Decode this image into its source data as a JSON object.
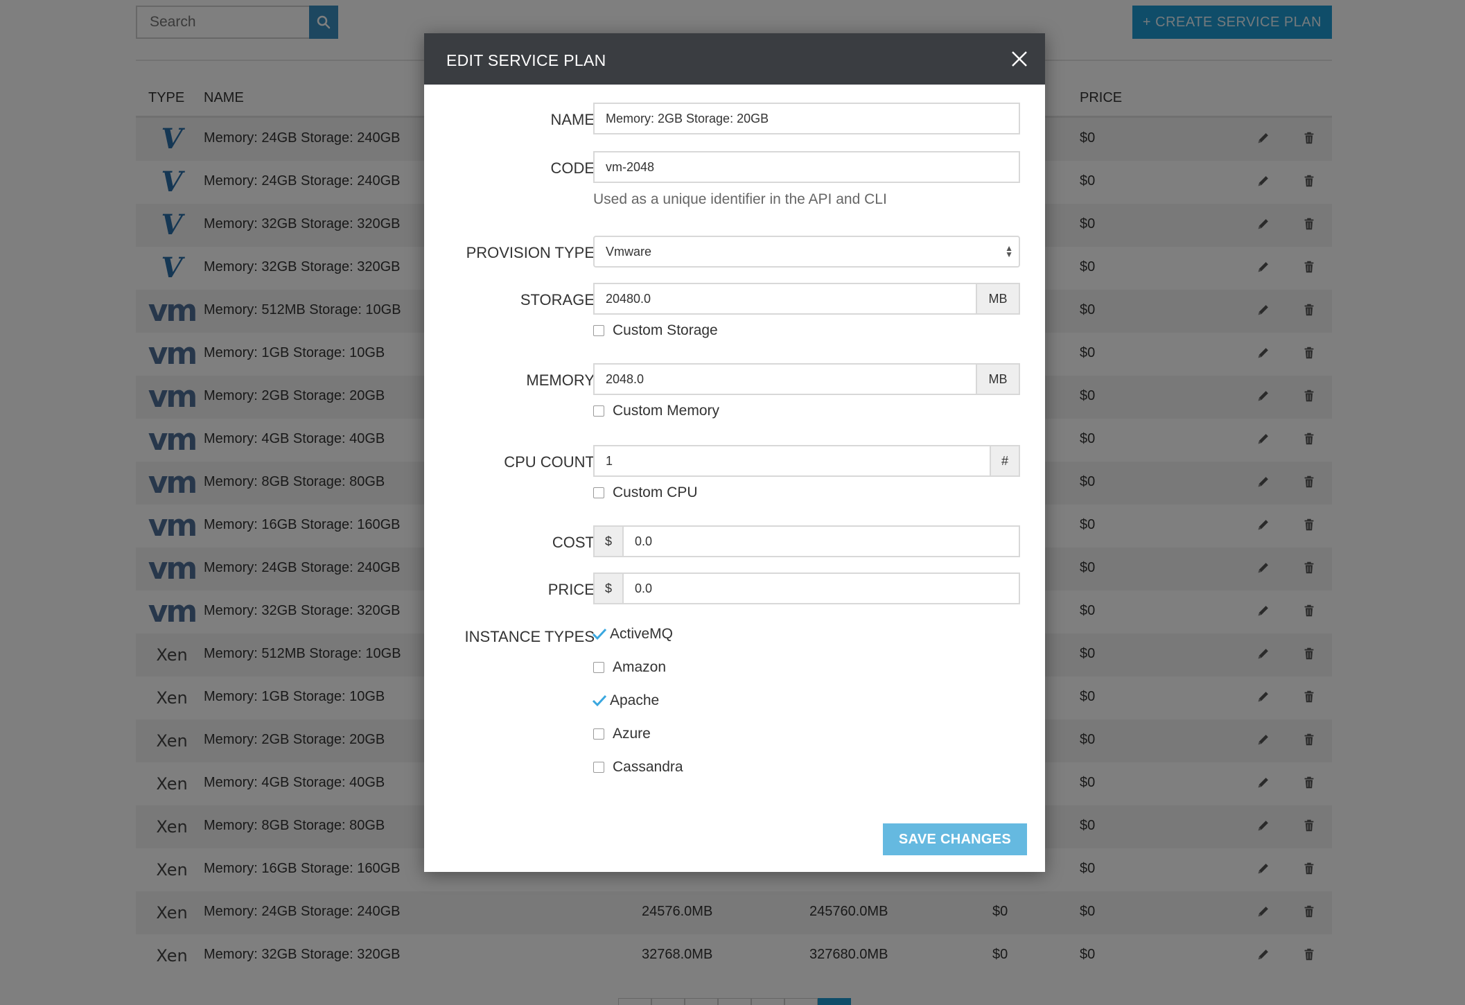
{
  "toolbar": {
    "search_placeholder": "Search",
    "create_label": "+ CREATE SERVICE PLAN"
  },
  "table": {
    "headers": {
      "type": "TYPE",
      "name": "NAME",
      "price": "PRICE"
    },
    "rows": [
      {
        "type": "vmware-v",
        "name": "Memory: 24GB Storage: 240GB",
        "memory": "",
        "storage": "",
        "cost": "",
        "price": "$0"
      },
      {
        "type": "vmware-v",
        "name": "Memory: 24GB Storage: 240GB",
        "memory": "",
        "storage": "",
        "cost": "",
        "price": "$0"
      },
      {
        "type": "vmware-v",
        "name": "Memory: 32GB Storage: 320GB",
        "memory": "",
        "storage": "",
        "cost": "",
        "price": "$0"
      },
      {
        "type": "vmware-v",
        "name": "Memory: 32GB Storage: 320GB",
        "memory": "",
        "storage": "",
        "cost": "",
        "price": "$0"
      },
      {
        "type": "vm",
        "name": "Memory: 512MB Storage: 10GB",
        "memory": "",
        "storage": "",
        "cost": "",
        "price": "$0"
      },
      {
        "type": "vm",
        "name": "Memory: 1GB Storage: 10GB",
        "memory": "",
        "storage": "",
        "cost": "",
        "price": "$0"
      },
      {
        "type": "vm",
        "name": "Memory: 2GB Storage: 20GB",
        "memory": "",
        "storage": "",
        "cost": "",
        "price": "$0"
      },
      {
        "type": "vm",
        "name": "Memory: 4GB Storage: 40GB",
        "memory": "",
        "storage": "",
        "cost": "",
        "price": "$0"
      },
      {
        "type": "vm",
        "name": "Memory: 8GB Storage: 80GB",
        "memory": "",
        "storage": "",
        "cost": "",
        "price": "$0"
      },
      {
        "type": "vm",
        "name": "Memory: 16GB Storage: 160GB",
        "memory": "",
        "storage": "",
        "cost": "",
        "price": "$0"
      },
      {
        "type": "vm",
        "name": "Memory: 24GB Storage: 240GB",
        "memory": "",
        "storage": "",
        "cost": "",
        "price": "$0"
      },
      {
        "type": "vm",
        "name": "Memory: 32GB Storage: 320GB",
        "memory": "",
        "storage": "",
        "cost": "",
        "price": "$0"
      },
      {
        "type": "xen",
        "name": "Memory: 512MB Storage: 10GB",
        "memory": "",
        "storage": "",
        "cost": "",
        "price": "$0"
      },
      {
        "type": "xen",
        "name": "Memory: 1GB Storage: 10GB",
        "memory": "",
        "storage": "",
        "cost": "",
        "price": "$0"
      },
      {
        "type": "xen",
        "name": "Memory: 2GB Storage: 20GB",
        "memory": "",
        "storage": "",
        "cost": "",
        "price": "$0"
      },
      {
        "type": "xen",
        "name": "Memory: 4GB Storage: 40GB",
        "memory": "",
        "storage": "",
        "cost": "",
        "price": "$0"
      },
      {
        "type": "xen",
        "name": "Memory: 8GB Storage: 80GB",
        "memory": "",
        "storage": "",
        "cost": "",
        "price": "$0"
      },
      {
        "type": "xen",
        "name": "Memory: 16GB Storage: 160GB",
        "memory": "",
        "storage": "",
        "cost": "",
        "price": "$0"
      },
      {
        "type": "xen",
        "name": "Memory: 24GB Storage: 240GB",
        "memory": "24576.0MB",
        "storage": "245760.0MB",
        "cost": "$0",
        "price": "$0"
      },
      {
        "type": "xen",
        "name": "Memory: 32GB Storage: 320GB",
        "memory": "32768.0MB",
        "storage": "327680.0MB",
        "cost": "$0",
        "price": "$0"
      }
    ],
    "logo_text": {
      "vmware-v": "V",
      "vm": "vm",
      "xen": "Xen"
    }
  },
  "modal": {
    "title": "EDIT SERVICE PLAN",
    "name": {
      "label": "NAME",
      "value": "Memory: 2GB Storage: 20GB"
    },
    "code": {
      "label": "CODE",
      "value": "vm-2048",
      "help": "Used as a unique identifier in the API and CLI"
    },
    "provision_type": {
      "label": "PROVISION TYPE",
      "value": "Vmware"
    },
    "storage": {
      "label": "STORAGE",
      "value": "20480.0",
      "unit": "MB",
      "custom_label": "Custom Storage",
      "custom_checked": false
    },
    "memory": {
      "label": "MEMORY",
      "value": "2048.0",
      "unit": "MB",
      "custom_label": "Custom Memory",
      "custom_checked": false
    },
    "cpu_count": {
      "label": "CPU COUNT",
      "value": "1",
      "unit": "#",
      "custom_label": "Custom CPU",
      "custom_checked": false
    },
    "cost": {
      "label": "COST",
      "prefix": "$",
      "value": "0.0"
    },
    "price": {
      "label": "PRICE",
      "prefix": "$",
      "value": "0.0"
    },
    "instance_types": {
      "label": "INSTANCE TYPES",
      "items": [
        {
          "label": "ActiveMQ",
          "checked": true
        },
        {
          "label": "Amazon",
          "checked": false
        },
        {
          "label": "Apache",
          "checked": true
        },
        {
          "label": "Azure",
          "checked": false
        },
        {
          "label": "Cassandra",
          "checked": false
        }
      ]
    },
    "save_label": "SAVE CHANGES"
  },
  "colors": {
    "accent": "#1f9bd2",
    "check": "#3aa7df",
    "header_bg": "#3a3d41",
    "save_btn": "#65b9e0"
  }
}
